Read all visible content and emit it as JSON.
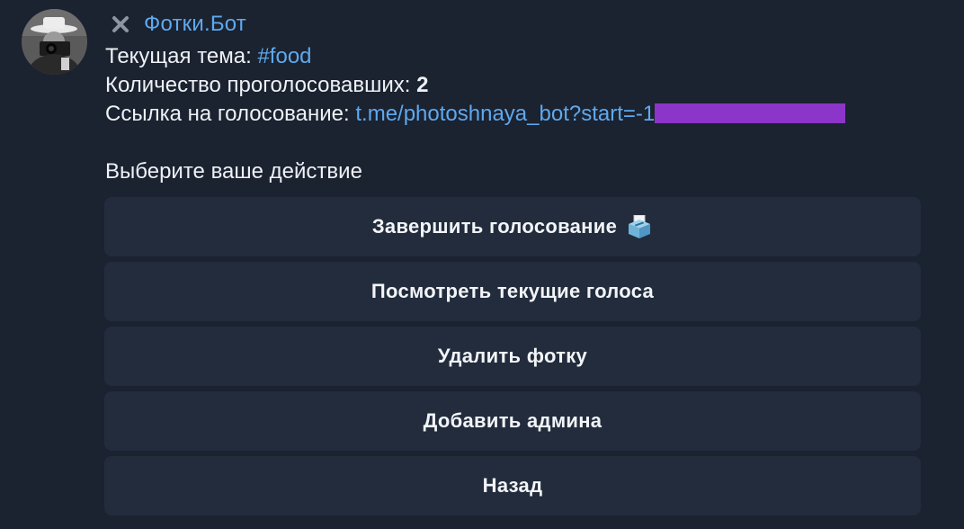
{
  "header": {
    "bot_name": "Фотки.Бот"
  },
  "message": {
    "theme_label": "Текущая тема: ",
    "theme_value": "#food",
    "voters_label": "Количество проголосовавших: ",
    "voters_value": "2",
    "link_label": "Ссылка на голосование: ",
    "link_value": "t.me/photoshnaya_bot?start=-1",
    "prompt": "Выберите ваше действие"
  },
  "buttons": [
    {
      "label": "Завершить голосование",
      "icon": "ballot-box-icon"
    },
    {
      "label": "Посмотреть текущие голоса"
    },
    {
      "label": "Удалить фотку"
    },
    {
      "label": "Добавить админа"
    },
    {
      "label": "Назад"
    }
  ],
  "colors": {
    "background": "#1b2230",
    "button_bg": "#222c3d",
    "link": "#5ea9ee",
    "redaction": "#8c35c9"
  }
}
